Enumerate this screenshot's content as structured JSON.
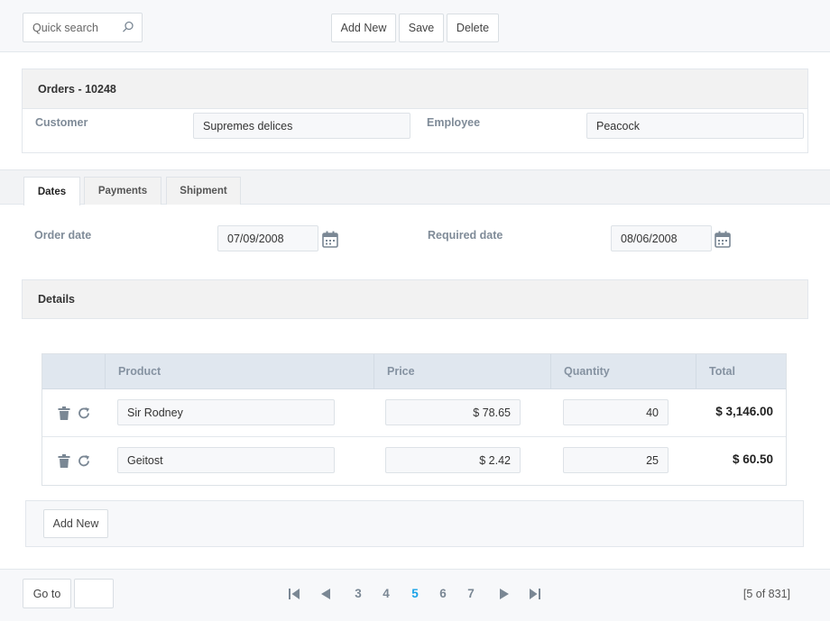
{
  "toolbar": {
    "search_placeholder": "Quick search",
    "search_icon": "search-icon",
    "add_new_label": "Add New",
    "save_label": "Save",
    "delete_label": "Delete"
  },
  "order": {
    "title": "Orders - 10248",
    "customer_label": "Customer",
    "customer_value": "Supremes delices",
    "employee_label": "Employee",
    "employee_value": "Peacock"
  },
  "tabs": [
    {
      "label": "Dates",
      "active": true
    },
    {
      "label": "Payments",
      "active": false
    },
    {
      "label": "Shipment",
      "active": false
    }
  ],
  "dates": {
    "order_date_label": "Order date",
    "order_date_value": "07/09/2008",
    "required_date_label": "Required date",
    "required_date_value": "08/06/2008",
    "calendar_icon": "calendar-icon"
  },
  "details": {
    "title": "Details",
    "columns": [
      "Product",
      "Price",
      "Quantity",
      "Total"
    ],
    "rows": [
      {
        "product": "Sir Rodney",
        "price": "$ 78.65",
        "quantity": "40",
        "total": "$ 3,146.00"
      },
      {
        "product": "Geitost",
        "price": "$ 2.42",
        "quantity": "25",
        "total": "$ 60.50"
      }
    ],
    "row_icons": [
      "trash-icon",
      "refresh-icon"
    ],
    "add_new_label": "Add New"
  },
  "pager": {
    "goto_label": "Go to",
    "goto_value": "",
    "pages": [
      "3",
      "4",
      "5",
      "6",
      "7"
    ],
    "current_page": "5",
    "info": "[5 of 831]",
    "icons": [
      "first-page-icon",
      "prev-page-icon",
      "next-page-icon",
      "last-page-icon"
    ]
  },
  "colors": {
    "accent": "#1aa3e8",
    "label": "#7f8b98",
    "grid_header": "#e0e7ef"
  }
}
